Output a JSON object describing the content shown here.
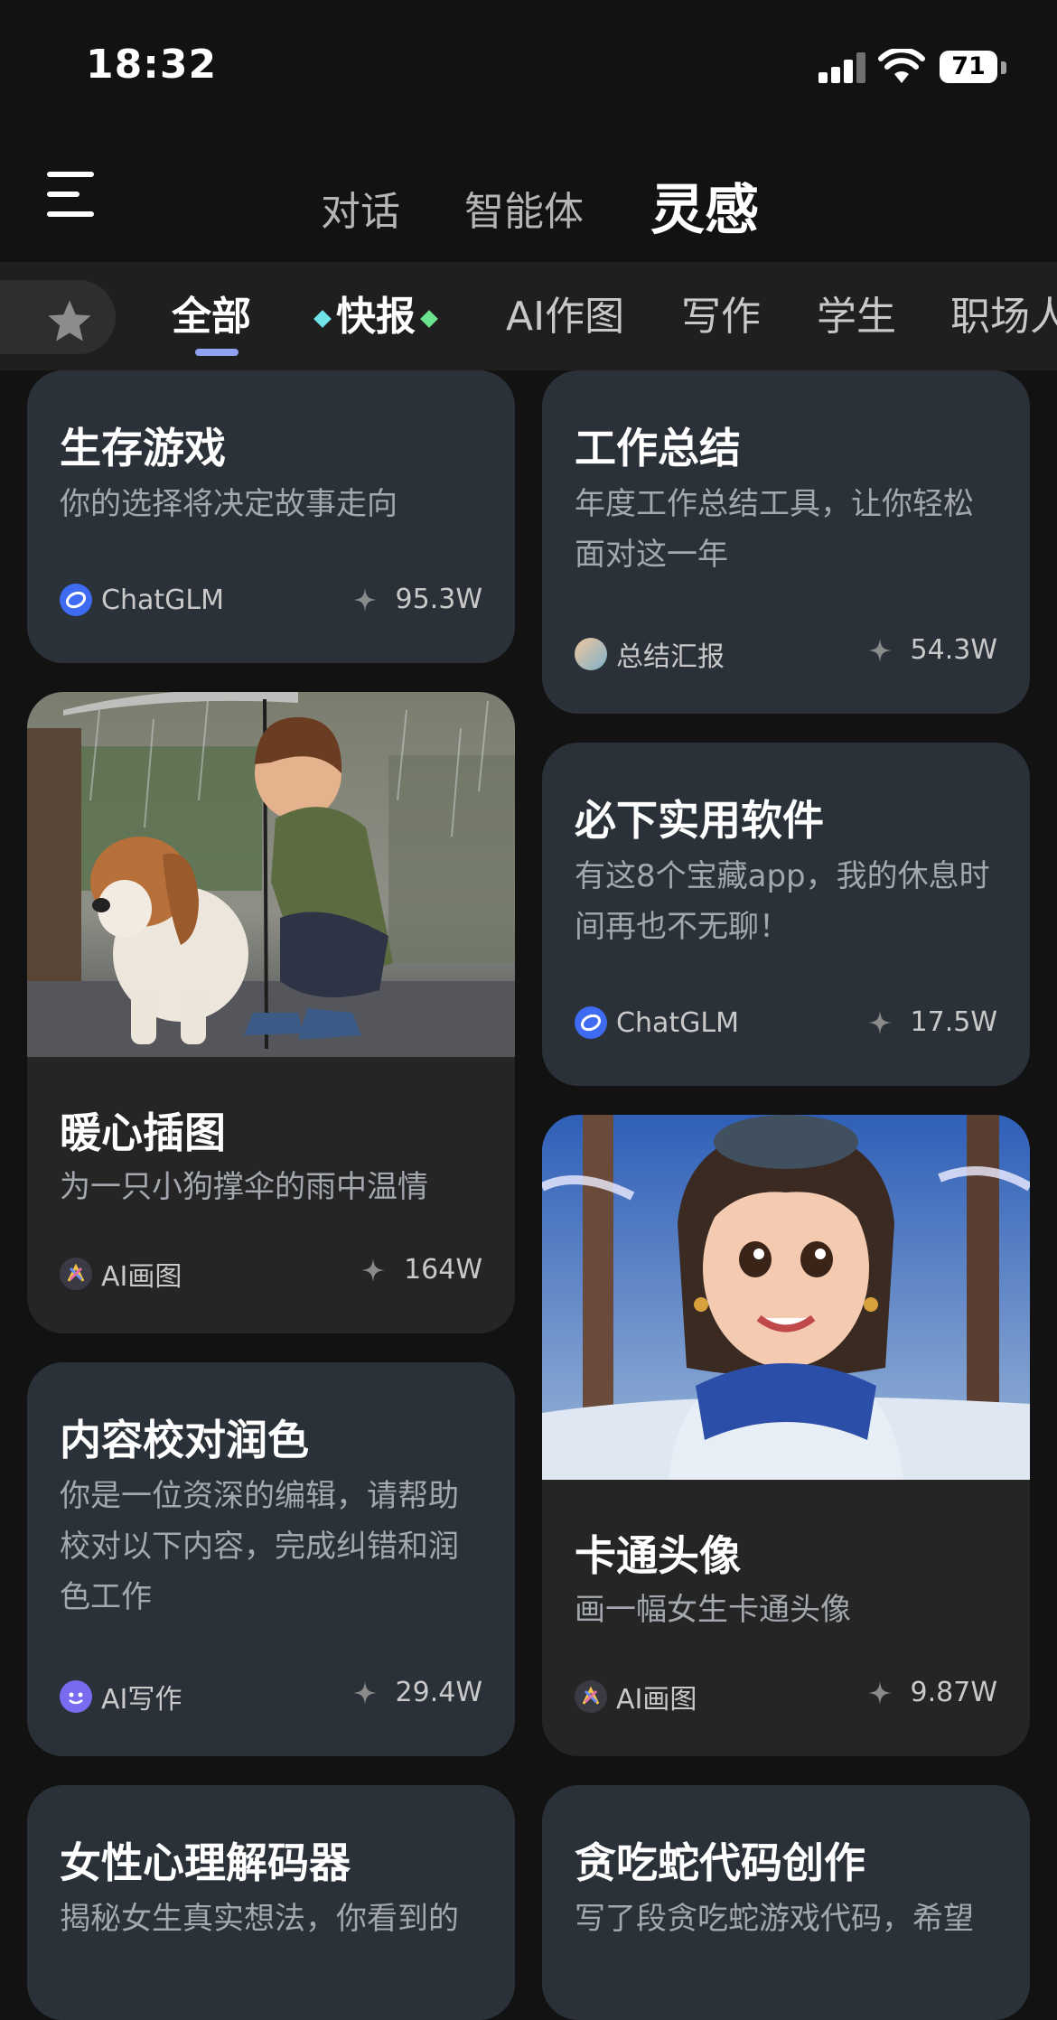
{
  "status_bar": {
    "time": "18:32",
    "battery": "71"
  },
  "header": {
    "tabs": [
      {
        "label": "对话"
      },
      {
        "label": "智能体"
      },
      {
        "label": "灵感"
      }
    ]
  },
  "categories": [
    {
      "label": "全部"
    },
    {
      "label": "快报"
    },
    {
      "label": "AI作图"
    },
    {
      "label": "写作"
    },
    {
      "label": "学生"
    },
    {
      "label": "职场人"
    }
  ],
  "cards": [
    {
      "title": "生存游戏",
      "desc": "你的选择将决定故事走向",
      "author": "ChatGLM",
      "count": "95.3W"
    },
    {
      "title": "工作总结",
      "desc": "年度工作总结工具，让你轻松面对这一年",
      "author": "总结汇报",
      "count": "54.3W"
    },
    {
      "title": "暖心插图",
      "desc": "为一只小狗撑伞的雨中温情",
      "author": "AI画图",
      "count": "164W"
    },
    {
      "title": "必下实用软件",
      "desc": "有这8个宝藏app，我的休息时间再也不无聊！",
      "author": "ChatGLM",
      "count": "17.5W"
    },
    {
      "title": "内容校对润色",
      "desc": "你是一位资深的编辑，请帮助校对以下内容，完成纠错和润色工作",
      "author": "AI写作",
      "count": "29.4W"
    },
    {
      "title": "卡通头像",
      "desc": "画一幅女生卡通头像",
      "author": "AI画图",
      "count": "9.87W"
    },
    {
      "title": "女性心理解码器",
      "desc": "揭秘女生真实想法，你看到的"
    },
    {
      "title": "贪吃蛇代码创作",
      "desc": "写了段贪吃蛇游戏代码，希望"
    }
  ],
  "colors": {
    "accent": "#8fa2f0",
    "card_bg": "#2b3138",
    "bg": "#121212"
  },
  "icons": [
    "menu-icon",
    "star-icon",
    "sparkle-icon",
    "chatglm-icon",
    "cellular-signal-icon",
    "wifi-icon",
    "battery-icon"
  ]
}
